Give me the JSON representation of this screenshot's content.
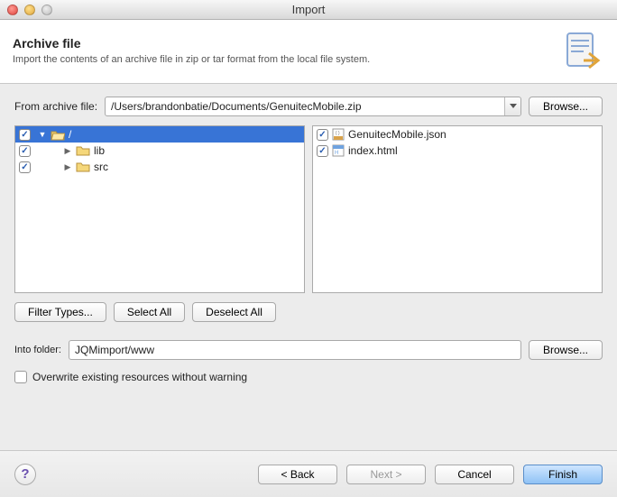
{
  "window": {
    "title": "Import"
  },
  "header": {
    "title": "Archive file",
    "subtitle": "Import the contents of an archive file in zip or tar format from the local file system."
  },
  "archive": {
    "label": "From archive file:",
    "value": "/Users/brandonbatie/Documents/GenuitecMobile.zip",
    "browse": "Browse..."
  },
  "tree": {
    "root": {
      "label": "/",
      "checked": true,
      "expanded": true
    },
    "children": [
      {
        "label": "lib",
        "checked": true
      },
      {
        "label": "src",
        "checked": true
      }
    ]
  },
  "files": [
    {
      "label": "GenuitecMobile.json",
      "checked": true,
      "kind": "json"
    },
    {
      "label": "index.html",
      "checked": true,
      "kind": "html"
    }
  ],
  "buttons": {
    "filter": "Filter Types...",
    "selectAll": "Select All",
    "deselectAll": "Deselect All"
  },
  "into": {
    "label": "Into folder:",
    "value": "JQMimport/www",
    "browse": "Browse..."
  },
  "overwrite": {
    "label": "Overwrite existing resources without warning",
    "checked": false
  },
  "wizard": {
    "back": "< Back",
    "next": "Next >",
    "cancel": "Cancel",
    "finish": "Finish"
  }
}
